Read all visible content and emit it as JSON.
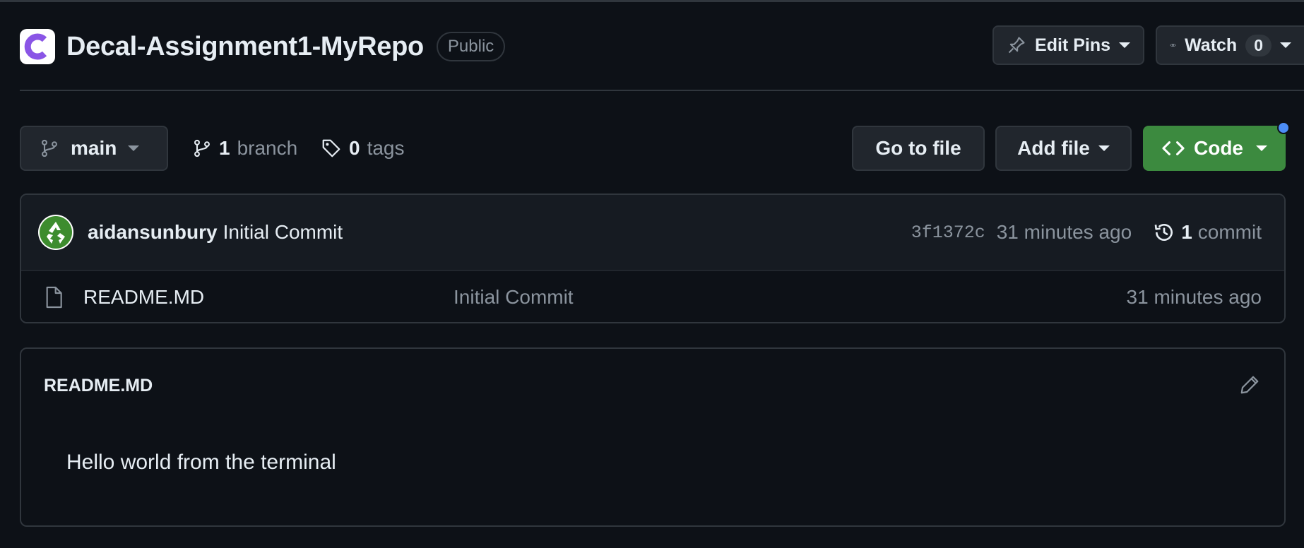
{
  "repo": {
    "name": "Decal-Assignment1-MyRepo",
    "visibility": "Public",
    "logo_letter": "C",
    "logo_color": "#8a55e6"
  },
  "header_actions": {
    "edit_pins_label": "Edit Pins",
    "watch_label": "Watch",
    "watch_count": "0"
  },
  "branch_bar": {
    "current_branch": "main",
    "branch_count": "1",
    "branch_label": "branch",
    "tag_count": "0",
    "tag_label": "tags"
  },
  "actions": {
    "go_to_file": "Go to file",
    "add_file": "Add file",
    "code": "Code"
  },
  "latest_commit": {
    "author": "aidansunbury",
    "message": "Initial Commit",
    "sha": "3f1372c",
    "time": "31 minutes ago",
    "count": "1",
    "count_label": "commit"
  },
  "files": [
    {
      "name": "README.MD",
      "commit_message": "Initial Commit",
      "time": "31 minutes ago"
    }
  ],
  "readme": {
    "title": "README.MD",
    "content": "Hello world from the terminal"
  },
  "colors": {
    "background": "#0d1117",
    "border": "#30363d",
    "code_button": "#3c8a3f",
    "muted_text": "#8b949e",
    "notification_dot": "#4c8df6"
  }
}
